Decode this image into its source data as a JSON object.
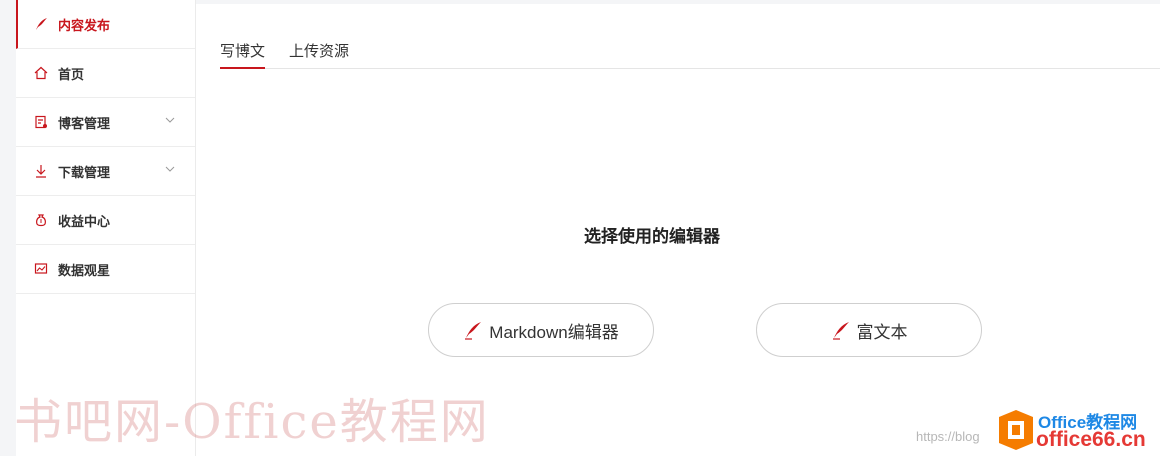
{
  "sidebar": {
    "items": [
      {
        "label": "内容发布",
        "icon": "quill-icon",
        "active": true
      },
      {
        "label": "首页",
        "icon": "home-icon"
      },
      {
        "label": "博客管理",
        "icon": "blog-icon",
        "expandable": true
      },
      {
        "label": "下载管理",
        "icon": "download-icon",
        "expandable": true
      },
      {
        "label": "收益中心",
        "icon": "money-bag-icon"
      },
      {
        "label": "数据观星",
        "icon": "chart-icon"
      }
    ]
  },
  "tabs": [
    {
      "label": "写博文",
      "active": true
    },
    {
      "label": "上传资源"
    }
  ],
  "main": {
    "heading": "选择使用的编辑器",
    "buttons": {
      "markdown": "Markdown编辑器",
      "richtext": "富文本"
    }
  },
  "watermarks": {
    "site": "书吧网-Office教程网",
    "url": "https://blog",
    "logo_top": "Office教程网",
    "logo_bottom": "office66.cn"
  },
  "colors": {
    "accent": "#c8161d"
  }
}
